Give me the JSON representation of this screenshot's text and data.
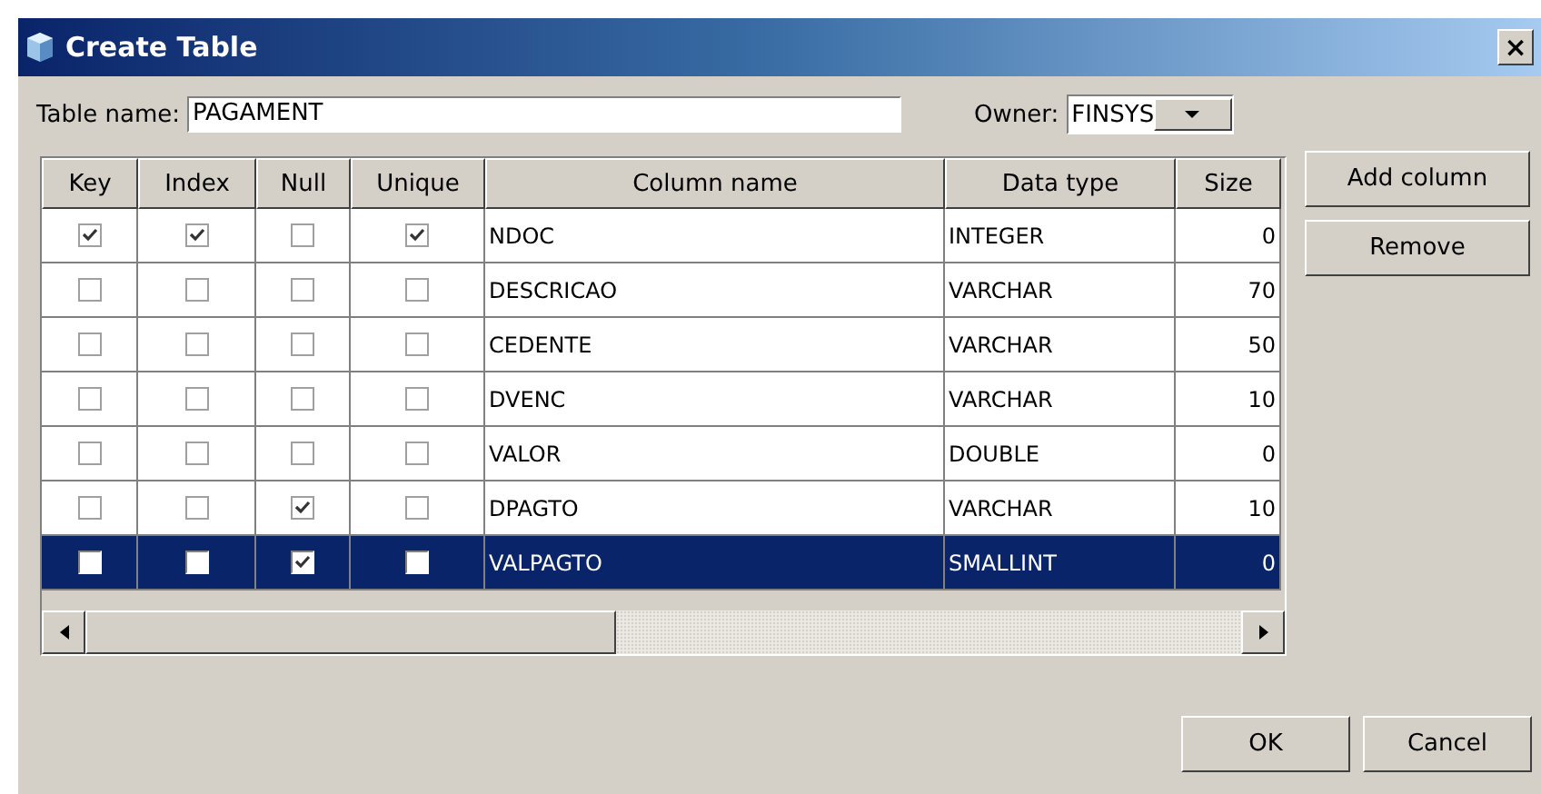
{
  "window": {
    "title": "Create Table",
    "close": "×"
  },
  "table_name": {
    "label": "Table name:",
    "value": "PAGAMENT"
  },
  "owner": {
    "label": "Owner:",
    "value": "FINSYS"
  },
  "table": {
    "columns": [
      "Key",
      "Index",
      "Null",
      "Unique",
      "Column name",
      "Data type",
      "Size"
    ],
    "rows": [
      {
        "key": true,
        "index": true,
        "null": false,
        "unique": true,
        "name": "NDOC",
        "type": "INTEGER",
        "size": "0",
        "selected": false
      },
      {
        "key": false,
        "index": false,
        "null": false,
        "unique": false,
        "name": "DESCRICAO",
        "type": "VARCHAR",
        "size": "70",
        "selected": false
      },
      {
        "key": false,
        "index": false,
        "null": false,
        "unique": false,
        "name": "CEDENTE",
        "type": "VARCHAR",
        "size": "50",
        "selected": false
      },
      {
        "key": false,
        "index": false,
        "null": false,
        "unique": false,
        "name": "DVENC",
        "type": "VARCHAR",
        "size": "10",
        "selected": false
      },
      {
        "key": false,
        "index": false,
        "null": false,
        "unique": false,
        "name": "VALOR",
        "type": "DOUBLE",
        "size": "0",
        "selected": false
      },
      {
        "key": false,
        "index": false,
        "null": true,
        "unique": false,
        "name": "DPAGTO",
        "type": "VARCHAR",
        "size": "10",
        "selected": false
      },
      {
        "key": false,
        "index": false,
        "null": true,
        "unique": false,
        "name": "VALPAGTO",
        "type": "SMALLINT",
        "size": "0",
        "selected": true
      }
    ]
  },
  "side_buttons": [
    "Add column",
    "Remove"
  ],
  "buttons": [
    "OK",
    "Cancel"
  ]
}
